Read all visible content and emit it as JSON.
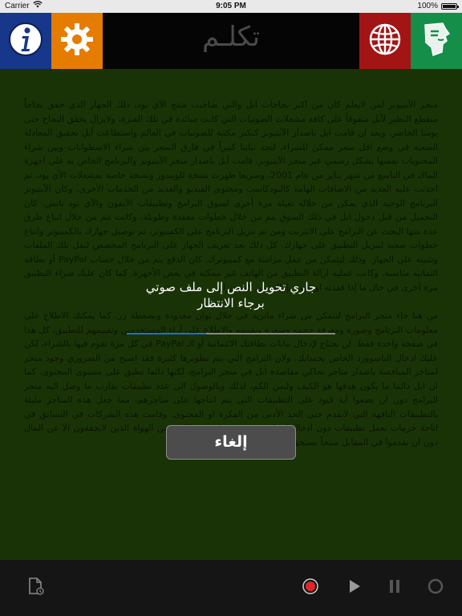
{
  "status_bar": {
    "carrier": "Carrier",
    "time": "9:05 PM",
    "battery": "100%"
  },
  "header": {
    "title": "تكلـم",
    "icons": {
      "info": "info-icon",
      "settings": "gear-icon",
      "globe": "globe-icon",
      "speech": "speech-icon"
    },
    "colors": {
      "info_tile": "#16378a",
      "settings_tile": "#e57c00",
      "globe_tile": "#a31515",
      "speech_tile": "#158e4a"
    }
  },
  "article": {
    "paragraphs": [
      "متجر الآيتيونز لمن لايعلم كان من اكبر نجاحات ابل والتي صاحبت منتج الآي بود، ذلك الجهاز الذي حقق نجاحاً منقطع النظير لأبل متفوقاً على كافة مشغلات الصوتيات التي كانت سائدة في تلك الفترة، ولايزال يحقق النجاح حتى يومنا الحاضر. وبعد ان قامت ابل باصدار الآيتيونز كتكبر مكتبة للصوتيات في العالم واستطاعت أبل تحقيق المعادلة الصعبة في وضع اقل سعر ممكن للشراء، لتجد تباينا كبيراً في فارق السعر بين شراء الاسطوانات وبين شراء المحتويات نفسها بشكل رسمي عبر متجر الآيتيونز. قامت أبل باصدار متجر الآيتيونز والبرنامج الخاص به على اجهزة الماك في التاسع من شهر يناير من عام 2001، وسريعا ظهرت نسخة للويندوز ونسخة خاصة بمشغلات الآي بود، ثم احدثت عليه العديد من الاضافات الهامة كالبودكاست ومحتوى الفيديو والعديد من الخدمات الأخرى، وكان الآيتيونز البرنامج الوحيد الذي يمكن من خلاله تعبئة مرة أخرى لسوق البرامج وتطبيقات الآيفون والآي بود تاتش. كان التحميل من قبل دخول ابل في ذلك السوق يتم من خلال خطوات معقدة وطويلة، وكانت تتم من خلال اتباع طرق عدة منها البحث عن البرامج على الانترنت ومن ثم تنزيل البرنامج على الكمبيوتر، ثم توصيل جهازك بالكمبيوتر واتباع خطوات صعبة لتنزيل التطبيق على جهازك. كل ذلك بعد تعريف الجهاز على البرنامج المخصص لنقل تلك الملفات وتثبيته على الجهاز. وذلك ليتمكن من عمل مزامنة مع كمبيوترك. كان الدفع يتم من خلال حساب PayPal أو بطاقة ائتمانية مناسبة، وكانت عملية ازالة التطبيق من الهاتف غير ممكنة في بعض الأجهزة. كما كان عليك شراء التطبيق مرة أخرى في حال ما إذا فقدته او قمت بإزالته من كمبيوترك.",
      "من هنا جاء متجر البرامج لتتمكن من شراء ماتريد في خلال ثوان معدودة وبضغطة زر. كما يمكنك الاطلاع على معلومات البرنامج وصوره ومعرفة حجمه وسعره وتقييمه والاطلاع على آراء المستخدمين وتقييمهم للتطبيق، كل هذا في صفحة واحدة فقط. لن تحتاج لإدخال بيانات بطاقتك الائتمانية أو الـ PayPal في كل مرة تقوم فيها بالشراء، لكن عليك ادخال الباسوورد الخاص بحسابك. ولان البرامج التي يتم تطويرها كثيرة فقد اصبح من الضروري وجود متجر لمتاجر المنافسة باصدار متاجر تحاكي مقاصده ابل في متجر البرامج، لكنها دائما تطبق على مستوى المحتوى. كما ان ابل دائما ما يكون هدفها هو الكيف وليس الكم، لذلك وبالوصول الى عدد تطبيقات يقارب ما وصل اليه متجر البرامج دون ان يضعوا أية قيود على التطبيقات التي يتم انتاجها على متاجرهم، مما جعل هذه المتاجر مليئة بالتطبيقات التافهة التي لاتقدم حتى الحد الأدنى من الفكرة او المحتوى. وقامت هذه الشركات في التسابق في اتاحة حزمات تعمل تطبيقات دون ادخال اي كود برمجي مما جذب الكثير من الهواة الذين لايحققون الا عن المال دون ان يقدموا في المقابل منتجاً يستحق البيع فعلاً."
    ],
    "background": "#1e3c08"
  },
  "loading": {
    "line1": "جاري تحويل النص إلى ملف صوتي",
    "line2": "برجاء الانتظار",
    "progress": 0.38,
    "progress_color": "#1e6fd8"
  },
  "cancel_label": "إلغاء",
  "toolbar": {
    "icons": [
      "document-icon",
      "record-icon",
      "play-icon",
      "pause-icon",
      "stop-icon"
    ],
    "record_color": "#e0262a"
  }
}
